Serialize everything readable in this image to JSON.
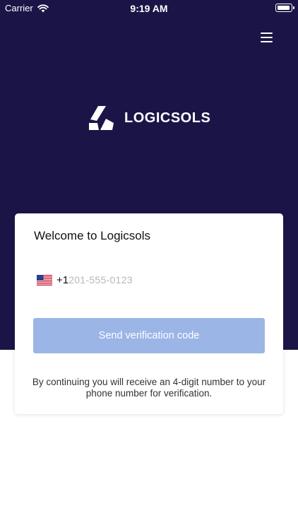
{
  "status_bar": {
    "carrier": "Carrier",
    "time": "9:19 AM"
  },
  "header": {
    "brand": "LOGICSOLS",
    "menu_icon": "hamburger-menu-icon",
    "background": "#1b1547"
  },
  "card": {
    "title": "Welcome to Logicsols",
    "phone": {
      "country_icon": "us-flag-icon",
      "dial_code": "+1",
      "placeholder": "201-555-0123",
      "value": ""
    },
    "submit_label": "Send verification code",
    "submit_color": "#9bb5e6",
    "disclaimer": "By continuing you will receive an 4-digit number to your phone number for verification."
  }
}
